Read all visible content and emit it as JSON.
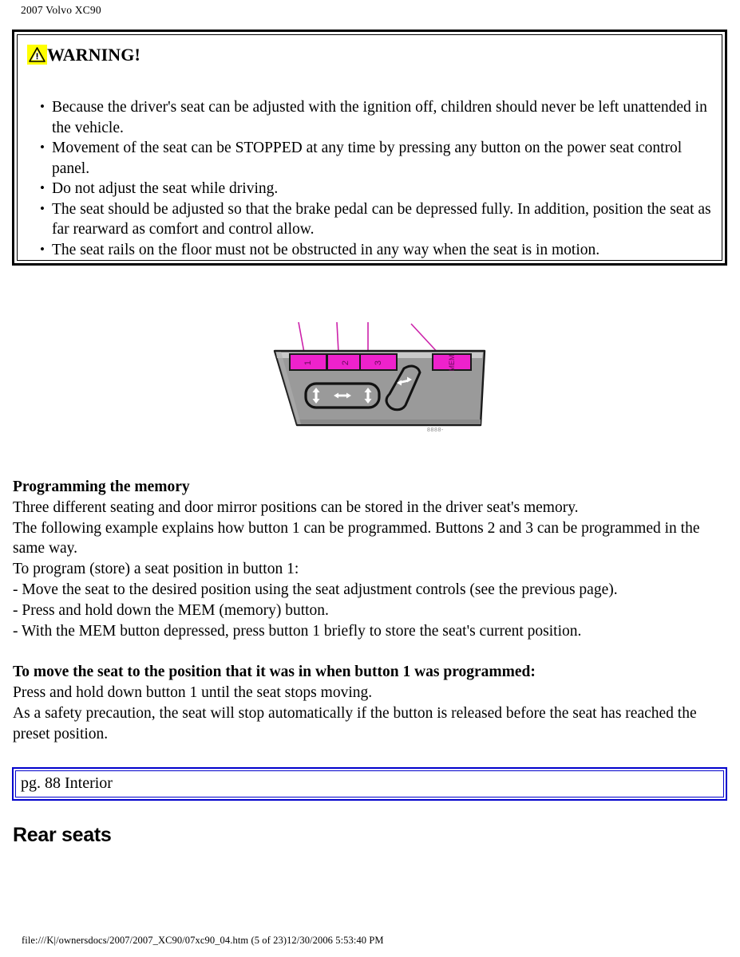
{
  "header": {
    "title": "2007 Volvo XC90"
  },
  "warning": {
    "icon": "warning-triangle-icon",
    "title": "WARNING!",
    "highlight_color": "#ffff00",
    "items": [
      "Because the driver's seat can be adjusted with the ignition off, children should never be left unattended in the vehicle.",
      "Movement of the seat can be STOPPED at any time by pressing any button on the power seat control panel.",
      "Do not adjust the seat while driving.",
      "The seat should be adjusted so that the brake pedal can be depressed fully. In addition, position the seat as far rearward as comfort and control allow.",
      "The seat rails on the floor must not be obstructed in any way when the seat is in motion."
    ]
  },
  "illustration": {
    "name": "power-seat-memory-control-panel",
    "callouts": [
      "1",
      "2",
      "3",
      "MEM"
    ],
    "button_color": "#ee22cc",
    "panel_color": "#999999",
    "leader_color": "#cc22aa",
    "reference_code": "8888-"
  },
  "content": {
    "programming_heading": "Programming the memory",
    "programming_lines": [
      "Three different seating and door mirror positions can be stored in the driver seat's memory.",
      "The following example explains how button 1 can be programmed. Buttons 2 and 3 can be programmed in the same way.",
      "To program (store) a seat position in button 1:",
      "- Move the seat to the desired position using the seat adjustment controls (see the previous page).",
      "- Press and hold down the MEM (memory) button.",
      "- With the MEM button depressed, press button 1 briefly to store the seat's current position."
    ],
    "move_heading": "To move the seat to the position that it was in when button 1 was programmed:",
    "move_lines": [
      "Press and hold down button 1 until the seat stops moving.",
      "As a safety precaution, the seat will stop automatically if the button is released before the seat has reached the preset position."
    ]
  },
  "page_link": {
    "label": "pg. 88 Interior",
    "border_color": "#0000cc"
  },
  "section": {
    "heading": "Rear seats"
  },
  "footer": {
    "text": "file:///K|/ownersdocs/2007/2007_XC90/07xc90_04.htm (5 of 23)12/30/2006 5:53:40 PM"
  }
}
